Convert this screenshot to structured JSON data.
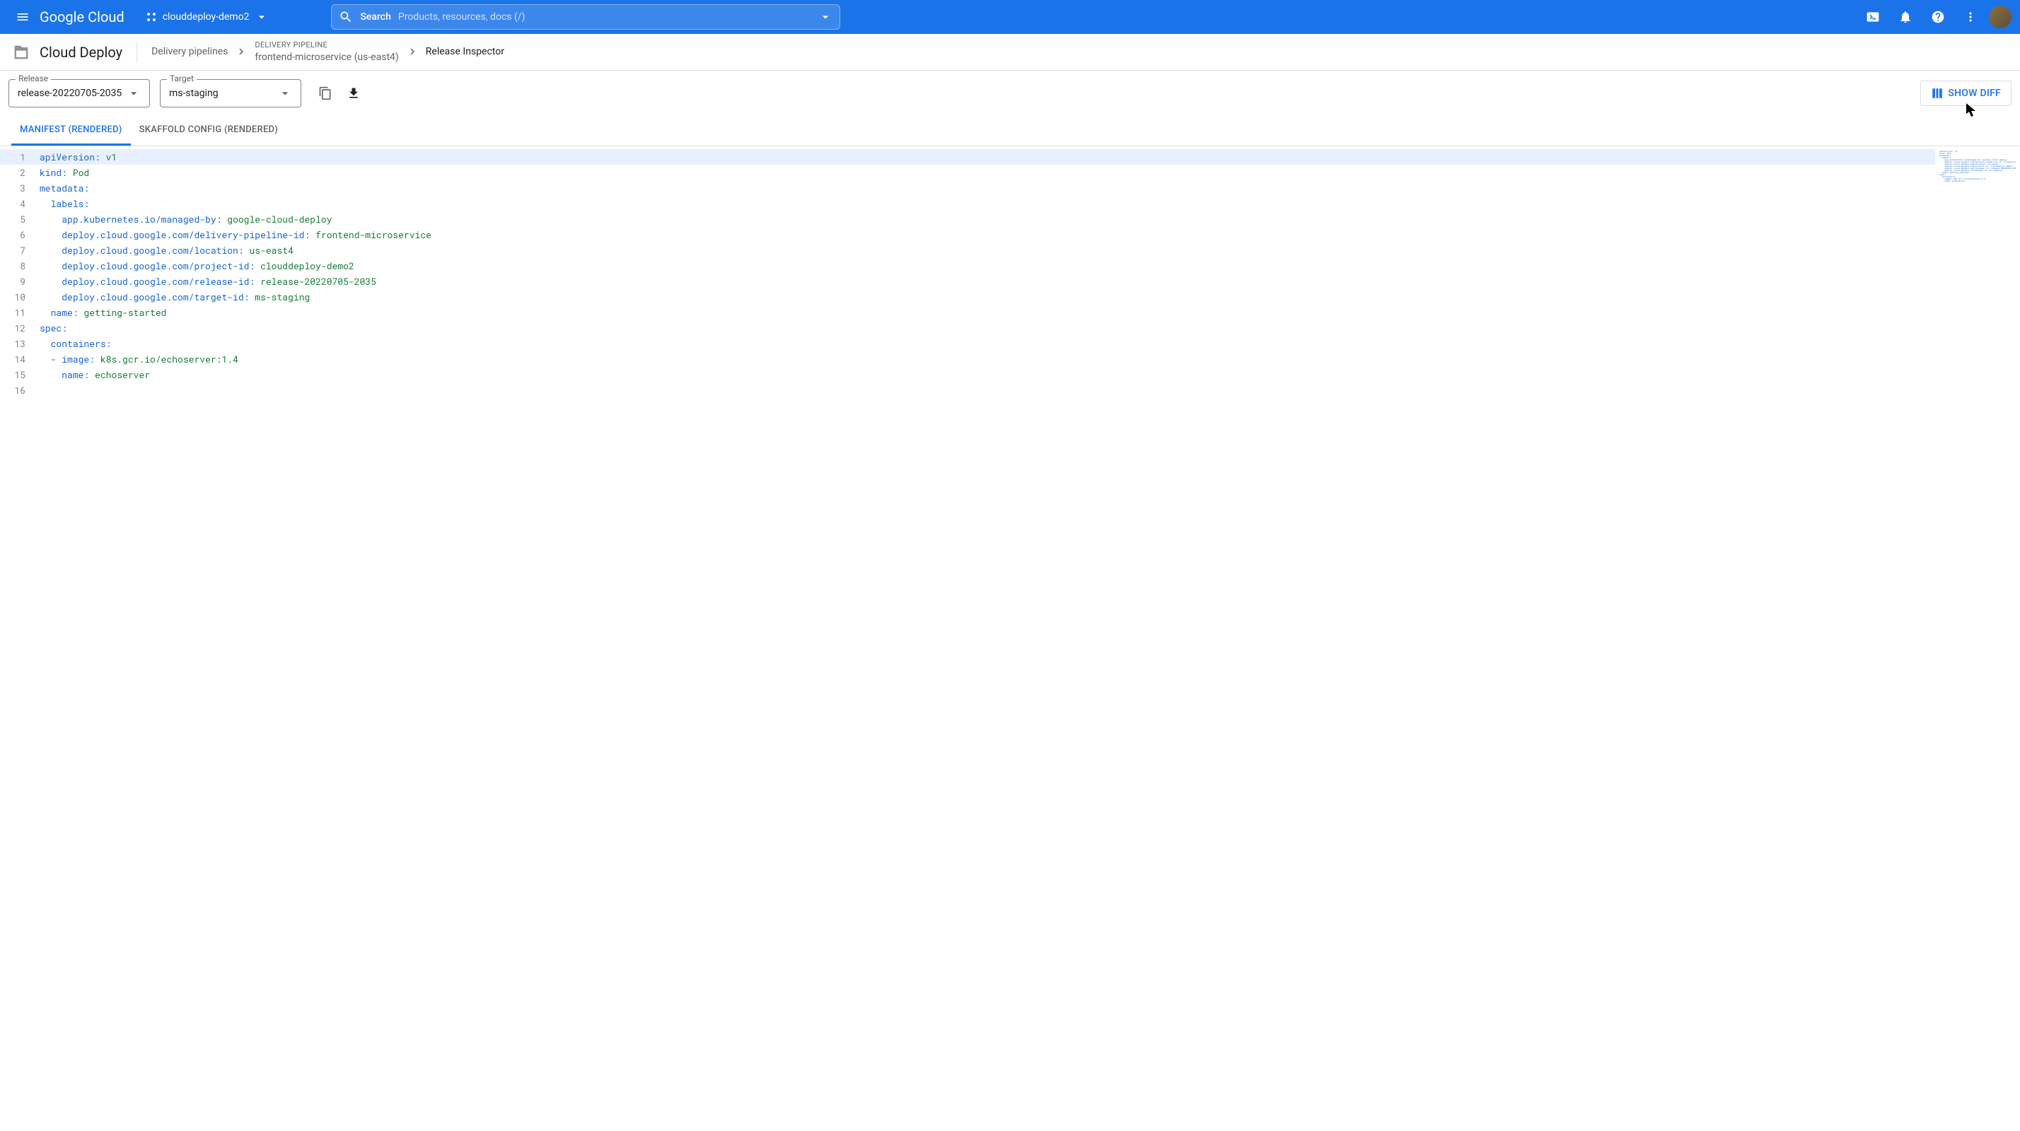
{
  "header": {
    "logo_text": "Google Cloud",
    "project_name": "clouddeploy-demo2",
    "search_label": "Search",
    "search_placeholder": "Products, resources, docs (/)"
  },
  "breadcrumb": {
    "service_name": "Cloud Deploy",
    "items": [
      {
        "label": "Delivery pipelines"
      },
      {
        "stack_label": "DELIVERY PIPELINE",
        "stack_value": "frontend-microservice (us-east4)"
      },
      {
        "label": "Release Inspector",
        "current": true
      }
    ]
  },
  "toolbar": {
    "release_label": "Release",
    "release_value": "release-20220705-2035",
    "target_label": "Target",
    "target_value": "ms-staging",
    "show_diff_label": "SHOW DIFF"
  },
  "tabs": [
    {
      "label": "MANIFEST (RENDERED)",
      "active": true
    },
    {
      "label": "SKAFFOLD CONFIG (RENDERED)",
      "active": false
    }
  ],
  "code": {
    "highlighted_line": 1,
    "lines": [
      {
        "n": 1,
        "indent": 0,
        "tokens": [
          {
            "t": "key",
            "v": "apiVersion"
          },
          {
            "t": "punc",
            "v": ": "
          },
          {
            "t": "str",
            "v": "v1"
          }
        ]
      },
      {
        "n": 2,
        "indent": 0,
        "tokens": [
          {
            "t": "key",
            "v": "kind"
          },
          {
            "t": "punc",
            "v": ": "
          },
          {
            "t": "str",
            "v": "Pod"
          }
        ]
      },
      {
        "n": 3,
        "indent": 0,
        "tokens": [
          {
            "t": "key",
            "v": "metadata"
          },
          {
            "t": "punc",
            "v": ":"
          }
        ]
      },
      {
        "n": 4,
        "indent": 1,
        "tokens": [
          {
            "t": "key",
            "v": "labels"
          },
          {
            "t": "punc",
            "v": ":"
          }
        ]
      },
      {
        "n": 5,
        "indent": 2,
        "tokens": [
          {
            "t": "key",
            "v": "app.kubernetes.io/managed-by"
          },
          {
            "t": "punc",
            "v": ": "
          },
          {
            "t": "str",
            "v": "google-cloud-deploy"
          }
        ]
      },
      {
        "n": 6,
        "indent": 2,
        "tokens": [
          {
            "t": "key",
            "v": "deploy.cloud.google.com/delivery-pipeline-id"
          },
          {
            "t": "punc",
            "v": ": "
          },
          {
            "t": "str",
            "v": "frontend-microservice"
          }
        ]
      },
      {
        "n": 7,
        "indent": 2,
        "tokens": [
          {
            "t": "key",
            "v": "deploy.cloud.google.com/location"
          },
          {
            "t": "punc",
            "v": ": "
          },
          {
            "t": "str",
            "v": "us-east4"
          }
        ]
      },
      {
        "n": 8,
        "indent": 2,
        "tokens": [
          {
            "t": "key",
            "v": "deploy.cloud.google.com/project-id"
          },
          {
            "t": "punc",
            "v": ": "
          },
          {
            "t": "str",
            "v": "clouddeploy-demo2"
          }
        ]
      },
      {
        "n": 9,
        "indent": 2,
        "tokens": [
          {
            "t": "key",
            "v": "deploy.cloud.google.com/release-id"
          },
          {
            "t": "punc",
            "v": ": "
          },
          {
            "t": "str",
            "v": "release-20220705-2035"
          }
        ]
      },
      {
        "n": 10,
        "indent": 2,
        "tokens": [
          {
            "t": "key",
            "v": "deploy.cloud.google.com/target-id"
          },
          {
            "t": "punc",
            "v": ": "
          },
          {
            "t": "str",
            "v": "ms-staging"
          }
        ]
      },
      {
        "n": 11,
        "indent": 1,
        "tokens": [
          {
            "t": "key",
            "v": "name"
          },
          {
            "t": "punc",
            "v": ": "
          },
          {
            "t": "str",
            "v": "getting-started"
          }
        ]
      },
      {
        "n": 12,
        "indent": 0,
        "tokens": [
          {
            "t": "key",
            "v": "spec"
          },
          {
            "t": "punc",
            "v": ":"
          }
        ]
      },
      {
        "n": 13,
        "indent": 1,
        "tokens": [
          {
            "t": "key",
            "v": "containers"
          },
          {
            "t": "punc",
            "v": ":"
          }
        ]
      },
      {
        "n": 14,
        "indent": 1,
        "tokens": [
          {
            "t": "dash",
            "v": "- "
          },
          {
            "t": "key",
            "v": "image"
          },
          {
            "t": "punc",
            "v": ": "
          },
          {
            "t": "str",
            "v": "k8s.gcr.io/echoserver:1.4"
          }
        ]
      },
      {
        "n": 15,
        "indent": 2,
        "tokens": [
          {
            "t": "key",
            "v": "name"
          },
          {
            "t": "punc",
            "v": ": "
          },
          {
            "t": "str",
            "v": "echoserver"
          }
        ]
      },
      {
        "n": 16,
        "indent": 0,
        "tokens": []
      }
    ]
  }
}
